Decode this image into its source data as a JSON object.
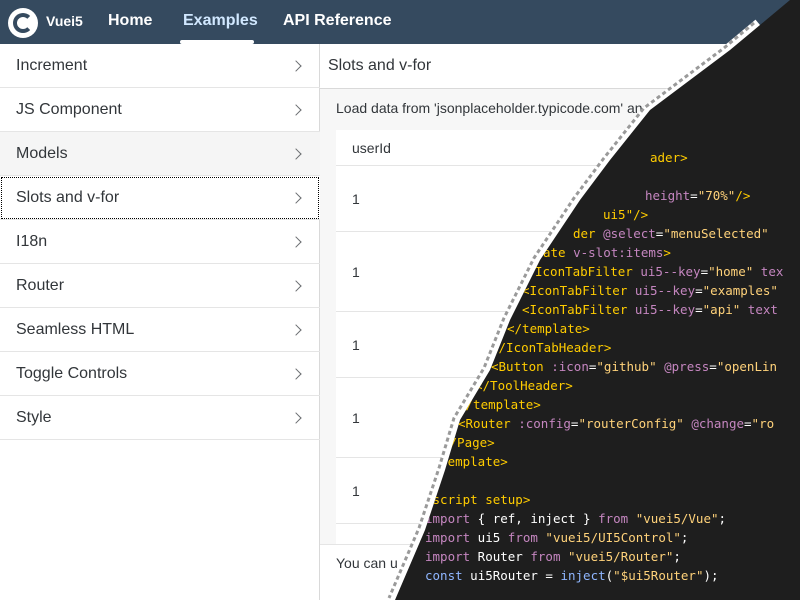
{
  "shellbar": {
    "brand": "Vuei5",
    "nav": [
      "Home",
      "Examples",
      "API Reference"
    ],
    "active": "Examples"
  },
  "sidenav": {
    "items": [
      "Increment",
      "JS Component",
      "Models",
      "Slots and v-for",
      "I18n",
      "Router",
      "Seamless HTML",
      "Toggle Controls",
      "Style"
    ],
    "selected": "Slots and v-for"
  },
  "detail": {
    "title": "Slots and v-for",
    "description": "Load data from 'jsonplaceholder.typicode.com' and displ",
    "table": {
      "column": "userId",
      "rows": [
        "1",
        "1",
        "1",
        "1",
        "1"
      ]
    },
    "footer": "You can u"
  },
  "code": {
    "lines": [
      "ader>",
      "\" height=\"70%\"/>",
      "ui5\"/>",
      "der @select=\"menuSelected\"",
      "ate v-slot:items>",
      "IconTabFilter ui5--key=\"home\" tex",
      "<IconTabFilter ui5--key=\"examples\"",
      "<IconTabFilter ui5--key=\"api\" text",
      "</template>",
      "</IconTabHeader>",
      "<Button :icon=\"github\" @press=\"openLin",
      "</ToolHeader>",
      "</template>",
      "<Router :config=\"routerConfig\" @change=\"ro",
      "</Page>",
      "</template>",
      "",
      "<script setup>",
      "import { ref, inject } from \"vuei5/Vue\";",
      "import ui5 from \"vuei5/UI5Control\";",
      "import Router from \"vuei5/Router\";",
      "const ui5Router = inject(\"$ui5Router\");"
    ]
  }
}
